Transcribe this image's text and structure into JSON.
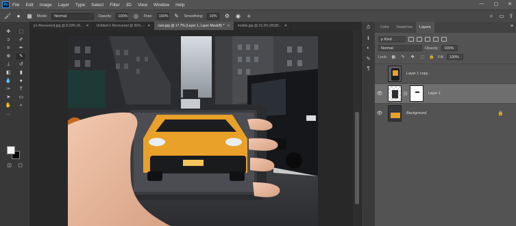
{
  "app": {
    "logo": "Ps",
    "menu": [
      "File",
      "Edit",
      "Image",
      "Layer",
      "Type",
      "Select",
      "Filter",
      "3D",
      "View",
      "Window",
      "Help"
    ],
    "window_controls": [
      "—",
      "▢",
      "✕"
    ]
  },
  "options_bar": {
    "mode_label": "Mode:",
    "mode_value": "Normal",
    "opacity_label": "Opacity:",
    "opacity_value": "100%",
    "flow_label": "Flow:",
    "flow_value": "100%",
    "smoothing_label": "Smoothing:",
    "smoothing_value": "10%"
  },
  "tabs": [
    {
      "label": "p1-Recovered.jpg @ 8.33% (R...",
      "close": "✕"
    },
    {
      "label": "Untitled-1-Recovered @ 50% ...",
      "close": "✕"
    },
    {
      "label": "cars.jpg @ 17.7% (Layer 1, Layer Mask/8) *",
      "close": "✕"
    },
    {
      "label": "mobile.jpg @ 16.3% (RGB/...",
      "close": "✕"
    }
  ],
  "panel": {
    "tabs": [
      "Color",
      "Swatches",
      "Layers"
    ],
    "kind_label": "ρ Kind",
    "blend_mode": "Normal",
    "opacity_label": "Opacity:",
    "opacity_value": "100%",
    "lock_label": "Lock:",
    "fill_label": "Fill:",
    "fill_value": "100%",
    "layers": [
      {
        "name": "Layer 1 copy",
        "visible": false
      },
      {
        "name": "Layer 1",
        "visible": true
      },
      {
        "name": "Background",
        "visible": true
      }
    ]
  },
  "colors": {
    "taxi": "#e9a12a",
    "selected_layer": "#6e6e6e",
    "accent": "#31a8ff"
  }
}
